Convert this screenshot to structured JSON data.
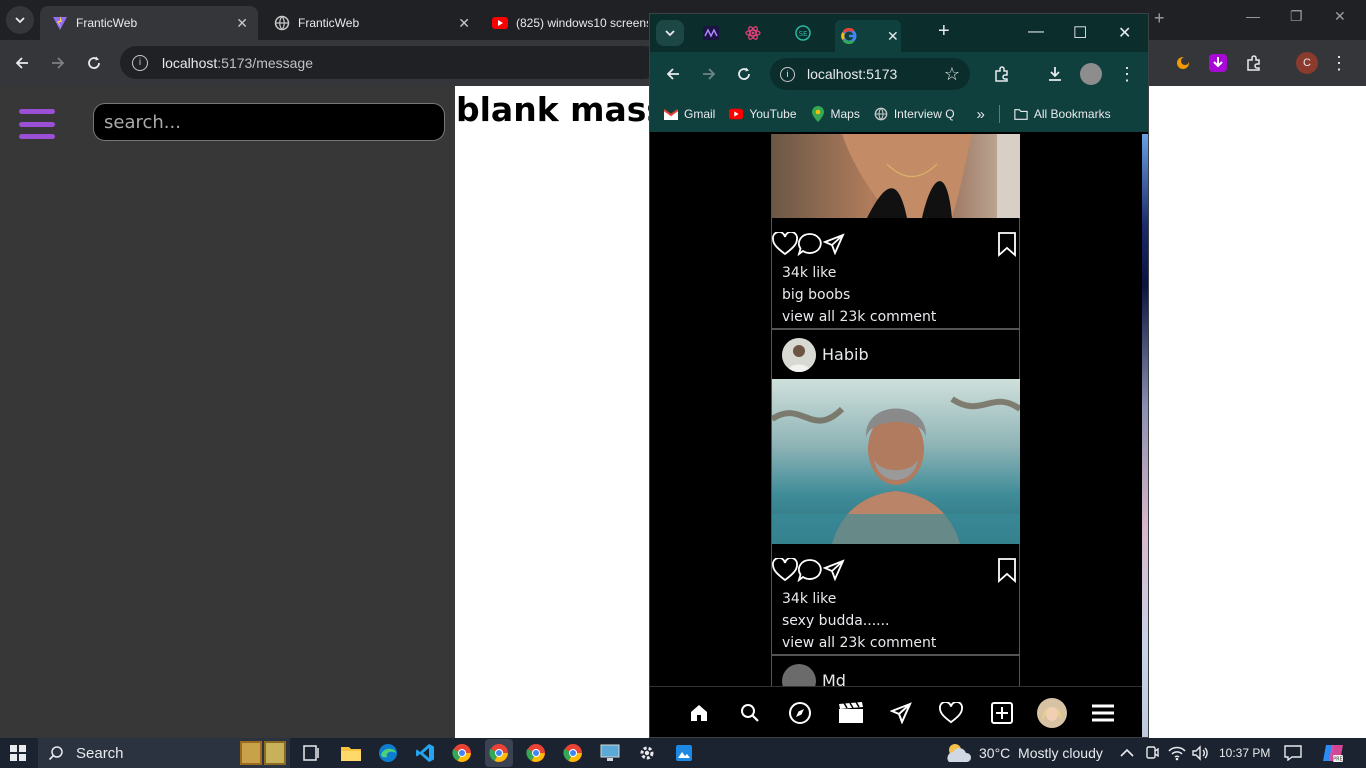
{
  "back_window": {
    "tabs": [
      {
        "title": "FranticWeb",
        "active": true
      },
      {
        "title": "FranticWeb",
        "active": false
      },
      {
        "title": "(825) windows10 screens",
        "active": false
      }
    ],
    "address": {
      "host": "localhost",
      "rest": ":5173/message"
    },
    "profile_initial": "C"
  },
  "app": {
    "search_placeholder": "search...",
    "page_title": "blank mass",
    "accent_color": "#9b4fd4"
  },
  "front_window": {
    "address": "localhost:5173",
    "bookmarks": [
      {
        "label": "Gmail",
        "icon": "gmail-icon"
      },
      {
        "label": "YouTube",
        "icon": "youtube-icon"
      },
      {
        "label": "Maps",
        "icon": "maps-icon"
      },
      {
        "label": "Interview Q",
        "icon": "globe-icon"
      }
    ],
    "bookmarks_more": "»",
    "all_bookmarks": "All Bookmarks",
    "posts": [
      {
        "user": "",
        "likes": "34k like",
        "caption": "big boobs",
        "comments": "view all 23k comment"
      },
      {
        "user": "Habib",
        "likes": "34k like",
        "caption": "sexy budda......",
        "comments": "view all 23k comment"
      },
      {
        "user": "Md",
        "likes": "",
        "caption": "",
        "comments": ""
      }
    ],
    "nav_icons": [
      "home-icon",
      "search-icon",
      "explore-icon",
      "reels-icon",
      "send-icon",
      "heart-icon",
      "add-post-icon",
      "profile-avatar",
      "menu-icon"
    ]
  },
  "taskbar": {
    "search_label": "Search",
    "weather": "30°C  Mostly cloudy",
    "time": "10:37 PM"
  }
}
